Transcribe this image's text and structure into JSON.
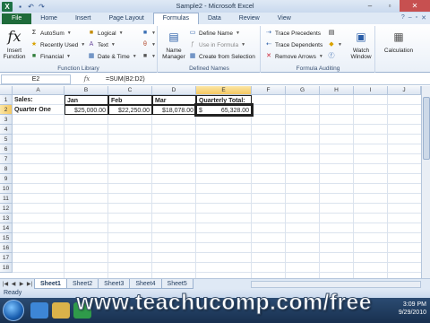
{
  "window": {
    "title": "Sample2 - Microsoft Excel",
    "app_icon": "X"
  },
  "ribbon": {
    "tabs": [
      "File",
      "Home",
      "Insert",
      "Page Layout",
      "Formulas",
      "Data",
      "Review",
      "View"
    ],
    "active_tab": "Formulas",
    "function_library": {
      "insert_function": "Insert Function",
      "autosum": "AutoSum",
      "recently_used": "Recently Used",
      "financial": "Financial",
      "logical": "Logical",
      "text": "Text",
      "date_time": "Date & Time",
      "label": "Function Library"
    },
    "defined_names": {
      "name_manager": "Name Manager",
      "define_name": "Define Name",
      "use_in_formula": "Use in Formula",
      "create_from_selection": "Create from Selection",
      "label": "Defined Names"
    },
    "formula_auditing": {
      "trace_precedents": "Trace Precedents",
      "trace_dependents": "Trace Dependents",
      "remove_arrows": "Remove Arrows",
      "watch_window": "Watch Window",
      "label": "Formula Auditing"
    },
    "calculation": {
      "calculation": "Calculation"
    }
  },
  "formula_bar": {
    "name_box": "E2",
    "fx": "fx",
    "formula": "=SUM(B2:D2)"
  },
  "grid": {
    "columns": [
      "A",
      "B",
      "C",
      "D",
      "E",
      "F",
      "G",
      "H",
      "I",
      "J"
    ],
    "rows": [
      "1",
      "2",
      "3",
      "4",
      "5",
      "6",
      "7",
      "8",
      "9",
      "10",
      "11",
      "12",
      "13",
      "14",
      "15",
      "16",
      "17",
      "18"
    ],
    "cells": {
      "A1": "Sales:",
      "B1": "Jan",
      "C1": "Feb",
      "D1": "Mar",
      "E1": "Quarterly Total:",
      "A2": "Quarter One",
      "B2": "$25,000.00",
      "C2": "$22,250.00",
      "D2": "$18,078.00",
      "E2_symbol": "$",
      "E2_value": "65,328.00"
    }
  },
  "sheets": [
    "Sheet1",
    "Sheet2",
    "Sheet3",
    "Sheet4",
    "Sheet5"
  ],
  "active_sheet": "Sheet1",
  "status": "Ready",
  "watermark": "www.teachucomp.com/free",
  "clock": {
    "time": "3:09 PM",
    "date": "9/29/2010"
  }
}
